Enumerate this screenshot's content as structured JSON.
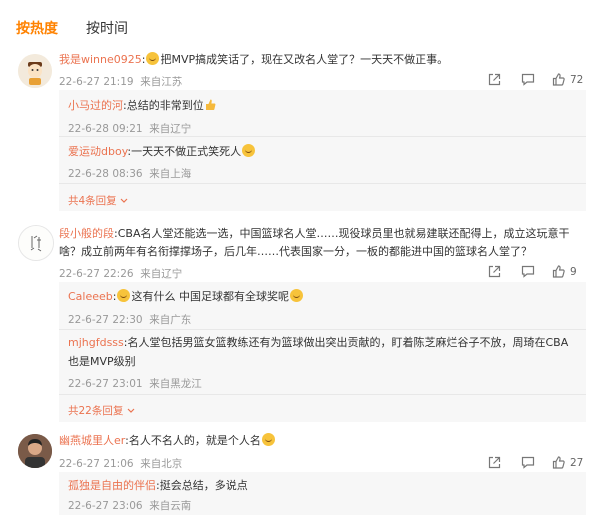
{
  "tabs": [
    {
      "label": "按热度",
      "active": true
    },
    {
      "label": "按时间",
      "active": false
    }
  ],
  "comments": [
    {
      "user": "我是winne0925",
      "sep": ":",
      "text": "把MVP搞成笑话了，现在又改名人堂了？一天天不做正事。",
      "time": "22-6-27 21:19",
      "location": "来自江苏",
      "likes": "72",
      "avatar_icon": "cartoon-avatar",
      "replies": [
        {
          "user": "小马过的河",
          "sep": ":",
          "text": "总结的非常到位",
          "emoji": "thumbs-up-emoji",
          "time": "22-6-28 09:21",
          "location": "来自辽宁"
        },
        {
          "user": "爱运动dboy",
          "sep": ":",
          "text": "一天天不做正式笑死人",
          "emoji": "laughing-emoji",
          "time": "22-6-28 08:36",
          "location": "来自上海"
        }
      ],
      "more": "共4条回复"
    },
    {
      "user": "段小般的段",
      "sep": ":",
      "text_line1": "CBA名人堂还能选一选，中国篮球名人堂……现役球员里也就易建联还配得上，成立这玩意干",
      "text_line2": "啥？成立前两年有名衔撑撑场子，后几年……代表国家一分，一板的都能进中国的篮球名人堂了？",
      "time": "22-6-27 22:26",
      "location": "来自辽宁",
      "likes": "9",
      "avatar_icon": "calligraphy-avatar",
      "replies": [
        {
          "user": "Caleeeb",
          "sep": ":",
          "text": "这有什么 中国足球都有全球奖呢",
          "emoji": "doge-emoji",
          "time": "22-6-27 22:30",
          "location": "来自广东"
        },
        {
          "user": "mjhgfdsss",
          "sep": ":",
          "text": "名人堂包括男篮女篮教练还有为篮球做出突出贡献的，盯着陈芝麻烂谷子不放，周琦在CBA",
          "text_line2": "也是MVP级别",
          "time": "22-6-27 23:01",
          "location": "来自黑龙江"
        }
      ],
      "more": "共22条回复"
    },
    {
      "user": "幽燕城里人er",
      "sep": ":",
      "text": "名人不名人的，就是个人名",
      "emoji": "doge-emoji",
      "time": "22-6-27 21:06",
      "location": "来自北京",
      "likes": "27",
      "avatar_icon": "photo-avatar",
      "replies": [
        {
          "user": "孤独是自由的伴侣",
          "sep": ":",
          "text": "挺会总结，多说点",
          "time": "22-6-27 23:06",
          "location": "来自云南"
        }
      ]
    }
  ],
  "colors": {
    "accent": "#ff8200",
    "username": "#eb7350",
    "meta": "#999999",
    "reply_bg": "#f7f7f7"
  },
  "icons": {
    "share": "share-icon",
    "comment": "comment-icon",
    "like": "like-icon"
  }
}
